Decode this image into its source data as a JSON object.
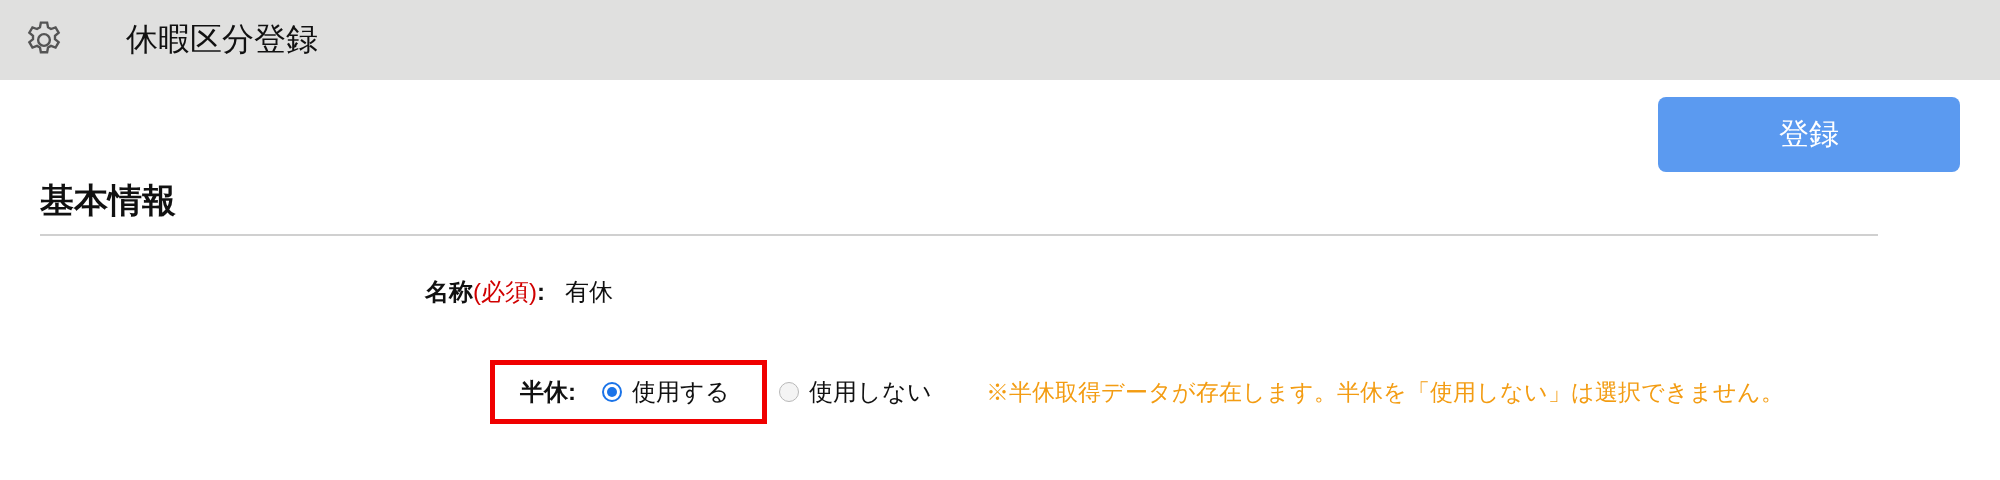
{
  "header": {
    "title": "休暇区分登録"
  },
  "register_button": "登録",
  "section": {
    "title": "基本情報"
  },
  "fields": [
    {
      "kind": "text",
      "label": "**名称**(必須)**:**",
      "value": "有休"
    },
    {
      "kind": "radio",
      "label": "半休:",
      "highlighted": true,
      "options": [
        {
          "label": "使用する",
          "selected": true
        },
        {
          "label": "使用しない",
          "selected": false
        }
      ],
      "note": "※半休取得データが存在します。半休を「使用しない」は選択できません。"
    }
  ]
}
